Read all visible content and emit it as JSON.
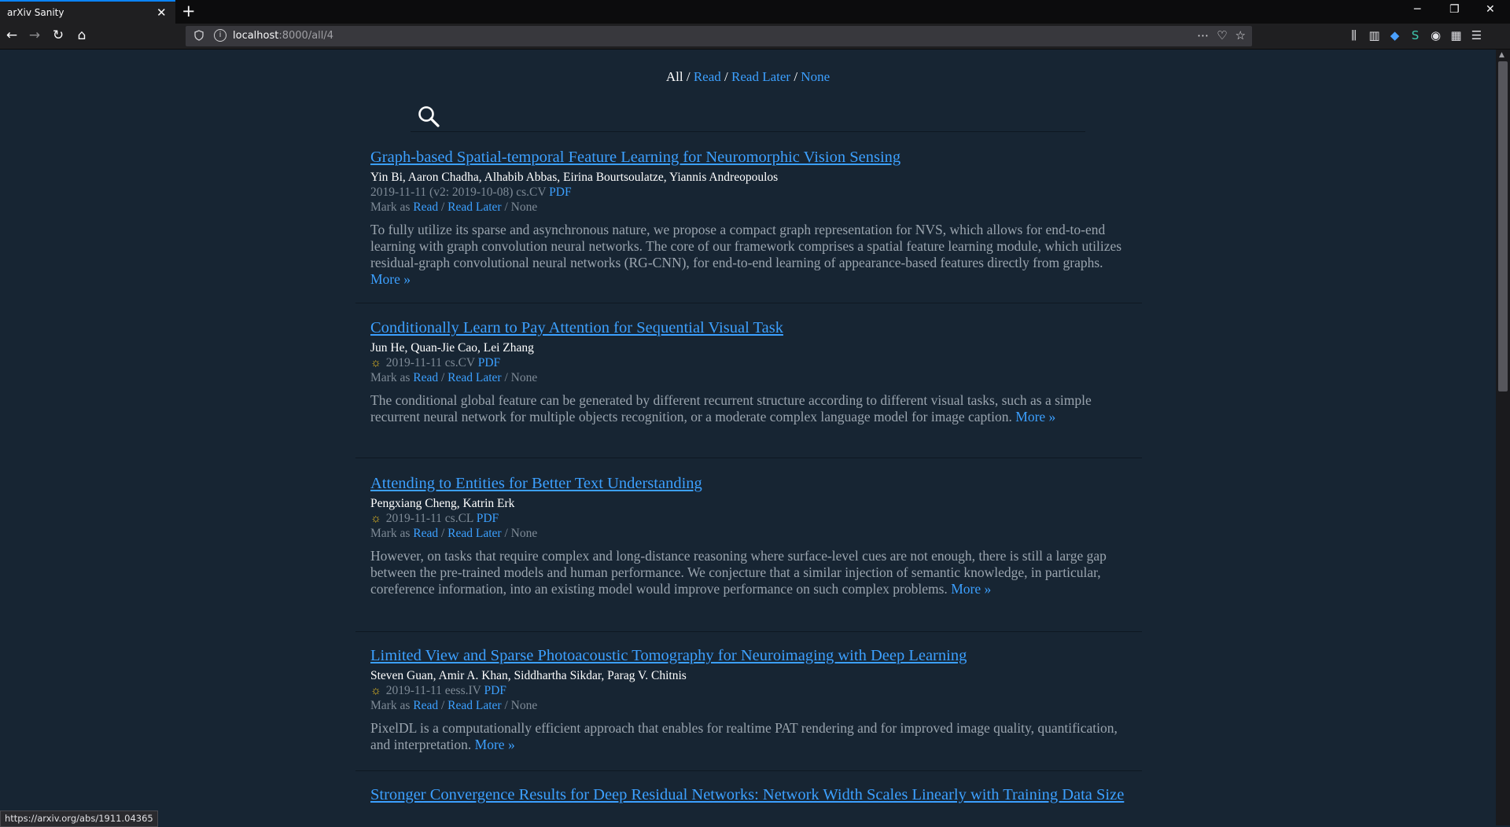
{
  "browser": {
    "tab_title": "arXiv Sanity",
    "tab_close": "✕",
    "new_tab": "+",
    "url_host": "localhost",
    "url_path": ":8000/all/4",
    "min": "─",
    "restore": "❐",
    "close": "✕",
    "status_url": "https://arxiv.org/abs/1911.04365"
  },
  "filter": {
    "all": "All",
    "sep": " / ",
    "read": "Read",
    "read_later": "Read Later",
    "none": "None"
  },
  "papers": [
    {
      "title": "Graph-based Spatial-temporal Feature Learning for Neuromorphic Vision Sensing",
      "authors": "Yin Bi, Aaron Chadha, Alhabib Abbas, Eirina Bourtsoulatze, Yiannis Andreopoulos",
      "meta": "2019-11-11 (v2: 2019-10-08) cs.CV",
      "pdf": "PDF",
      "mark_prefix": "Mark as",
      "read": "Read",
      "slash": " / ",
      "read_later": "Read Later",
      "none": " / None",
      "abstract": "To fully utilize its sparse and asynchronous nature, we propose a compact graph representation for NVS, which allows for end-to-end learning with graph convolution neural networks. The core of our framework comprises a spatial feature learning module, which utilizes residual-graph convolutional neural networks (RG-CNN), for end-to-end learning of appearance-based features directly from graphs.",
      "more": "More »"
    },
    {
      "title": "Conditionally Learn to Pay Attention for Sequential Visual Task",
      "authors": "Jun He, Quan-Jie Cao, Lei Zhang",
      "meta": "2019-11-11 cs.CV",
      "pdf": "PDF",
      "mark_prefix": "Mark as",
      "read": "Read",
      "slash": " / ",
      "read_later": "Read Later",
      "none": " / None",
      "abstract": "The conditional global feature can be generated by different recurrent structure according to different visual tasks, such as a simple recurrent neural network for multiple objects recognition, or a moderate complex language model for image caption.",
      "more": "More »"
    },
    {
      "title": "Attending to Entities for Better Text Understanding",
      "authors": "Pengxiang Cheng, Katrin Erk",
      "meta": "2019-11-11 cs.CL",
      "pdf": "PDF",
      "mark_prefix": "Mark as",
      "read": "Read",
      "slash": " / ",
      "read_later": "Read Later",
      "none": " / None",
      "abstract": "However, on tasks that require complex and long-distance reasoning where surface-level cues are not enough, there is still a large gap between the pre-trained models and human performance. We conjecture that a similar injection of semantic knowledge, in particular, coreference information, into an existing model would improve performance on such complex problems.",
      "more": "More »"
    },
    {
      "title": "Limited View and Sparse Photoacoustic Tomography for Neuroimaging with Deep Learning",
      "authors": "Steven Guan, Amir A. Khan, Siddhartha Sikdar, Parag V. Chitnis",
      "meta": "2019-11-11 eess.IV",
      "pdf": "PDF",
      "mark_prefix": "Mark as",
      "read": "Read",
      "slash": " / ",
      "read_later": "Read Later",
      "none": " / None",
      "abstract": "PixelDL is a computationally efficient approach that enables for realtime PAT rendering and for improved image quality, quantification, and interpretation.",
      "more": "More »"
    },
    {
      "title": "Stronger Convergence Results for Deep Residual Networks: Network Width Scales Linearly with Training Data Size"
    }
  ]
}
